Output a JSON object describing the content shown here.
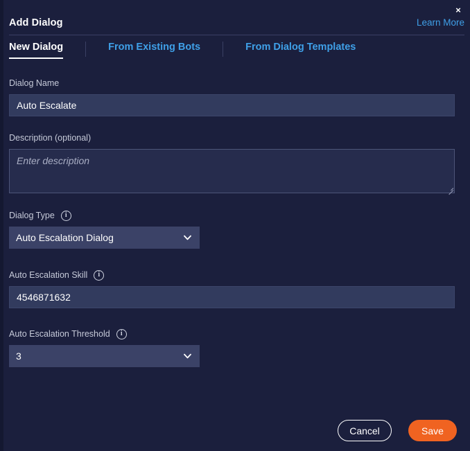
{
  "header": {
    "title": "Add Dialog",
    "learn_more_label": "Learn More",
    "close_icon": "close-icon",
    "close_glyph": "×"
  },
  "tabs": [
    {
      "label": "New Dialog",
      "active": true
    },
    {
      "label": "From Existing Bots",
      "active": false
    },
    {
      "label": "From Dialog Templates",
      "active": false
    }
  ],
  "form": {
    "dialog_name": {
      "label": "Dialog Name",
      "value": "Auto Escalate",
      "placeholder": ""
    },
    "description": {
      "label": "Description (optional)",
      "value": "",
      "placeholder": "Enter description"
    },
    "dialog_type": {
      "label": "Dialog Type",
      "info_icon": "info-icon",
      "value": "Auto Escalation Dialog",
      "options": [
        "Auto Escalation Dialog"
      ]
    },
    "auto_escalation_skill": {
      "label": "Auto Escalation Skill",
      "info_icon": "info-icon",
      "value": "4546871632",
      "placeholder": ""
    },
    "auto_escalation_threshold": {
      "label": "Auto Escalation Threshold",
      "info_icon": "info-icon",
      "value": "3",
      "options": [
        "3"
      ]
    }
  },
  "footer": {
    "cancel_label": "Cancel",
    "save_label": "Save"
  },
  "colors": {
    "background": "#1b1f3d",
    "input_background": "#323b5e",
    "select_background": "#3b4267",
    "accent_link": "#3fa0e8",
    "save_button": "#f06321",
    "label_text": "#c6cad9",
    "divider": "#3b4064"
  }
}
